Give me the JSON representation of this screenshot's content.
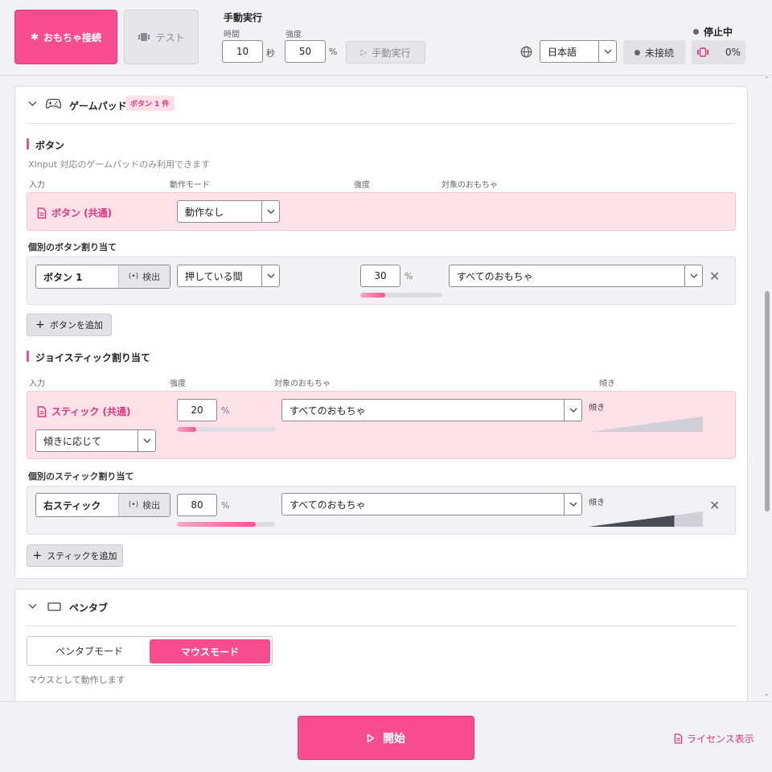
{
  "header": {
    "connect_label": "おもちゃ接続",
    "test_label": "テスト",
    "manual": {
      "title": "手動実行",
      "time_label": "時間",
      "time_value": "10",
      "time_unit": "秒",
      "intensity_label": "強度",
      "intensity_value": "50",
      "intensity_unit": "%",
      "run_label": "手動実行"
    },
    "language": "日本語",
    "connection_status": "未接続",
    "run_state": "停止中",
    "vibration_level": "0%"
  },
  "gamepad": {
    "title": "ゲームパッド",
    "badge": "ボタン 1 件",
    "buttons": {
      "title": "ボタン",
      "note": "XInput 対応のゲームパッドのみ利用できます",
      "columns": [
        "入力",
        "動作モード",
        "強度",
        "対象のおもちゃ"
      ],
      "common": {
        "label": "ボタン (共通)",
        "mode": "動作なし"
      },
      "individual_title": "個別のボタン割り当て",
      "rows": [
        {
          "input": "ボタン 1",
          "detect_label": "検出",
          "mode": "押している間",
          "intensity": "30",
          "intensity_level": 0.3,
          "unit": "%",
          "target": "すべてのおもちゃ"
        }
      ],
      "add_label": "ボタンを追加"
    },
    "sticks": {
      "title": "ジョイスティック割り当て",
      "columns": [
        "入力",
        "強度",
        "対象のおもちゃ",
        "傾き"
      ],
      "common": {
        "label": "スティック (共通)",
        "intensity": "20",
        "intensity_level": 0.2,
        "unit": "%",
        "target": "すべてのおもちゃ",
        "tilt_label": "傾き",
        "mode": "傾きに応じて",
        "tilt_level": 0.0
      },
      "individual_title": "個別のスティック割り当て",
      "rows": [
        {
          "input": "右スティック",
          "detect_label": "検出",
          "intensity": "80",
          "intensity_level": 0.8,
          "unit": "%",
          "target": "すべてのおもちゃ",
          "tilt_label": "傾き",
          "tilt_level": 0.75
        }
      ],
      "add_label": "スティックを追加"
    }
  },
  "pentab": {
    "title": "ペンタブ",
    "mode_options": [
      "ペンタブモード",
      "マウスモード"
    ],
    "selected_mode": "マウスモード",
    "note": "マウスとして動作します"
  },
  "footer": {
    "start_label": "開始",
    "license_label": "ライセンス表示"
  },
  "colors": {
    "accent": "#f84d8c",
    "accent_text": "#e0357a",
    "pink_bg": "#fde0e8"
  }
}
